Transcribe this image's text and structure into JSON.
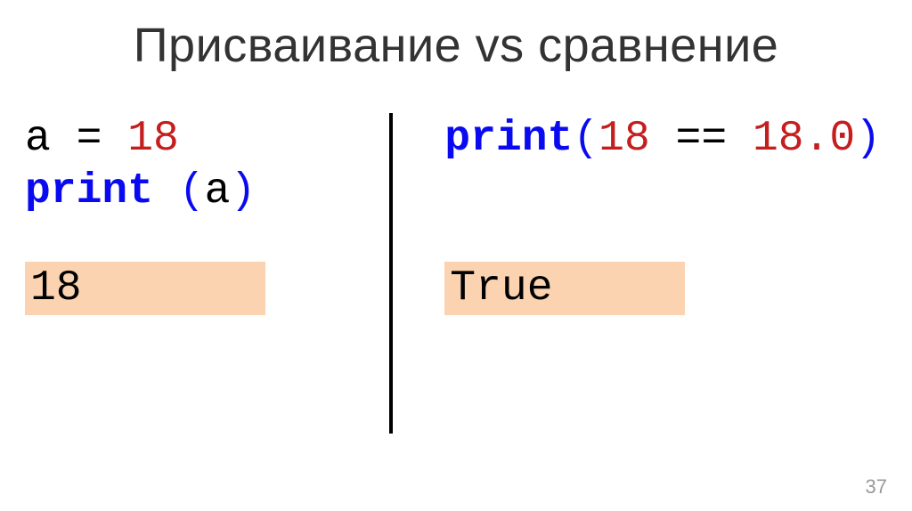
{
  "title": "Присваивание vs сравнение",
  "left": {
    "line1": {
      "var": "a",
      "op": " = ",
      "num": "18"
    },
    "line2": {
      "kw": "print",
      "space": " ",
      "open": "(",
      "arg": "a",
      "close": ")"
    },
    "output": "18"
  },
  "right": {
    "line1": {
      "kw": "print",
      "open": "(",
      "arg1": "18",
      "op": " == ",
      "arg2": "18.0",
      "close": ")"
    },
    "output": "True"
  },
  "page_number": "37"
}
